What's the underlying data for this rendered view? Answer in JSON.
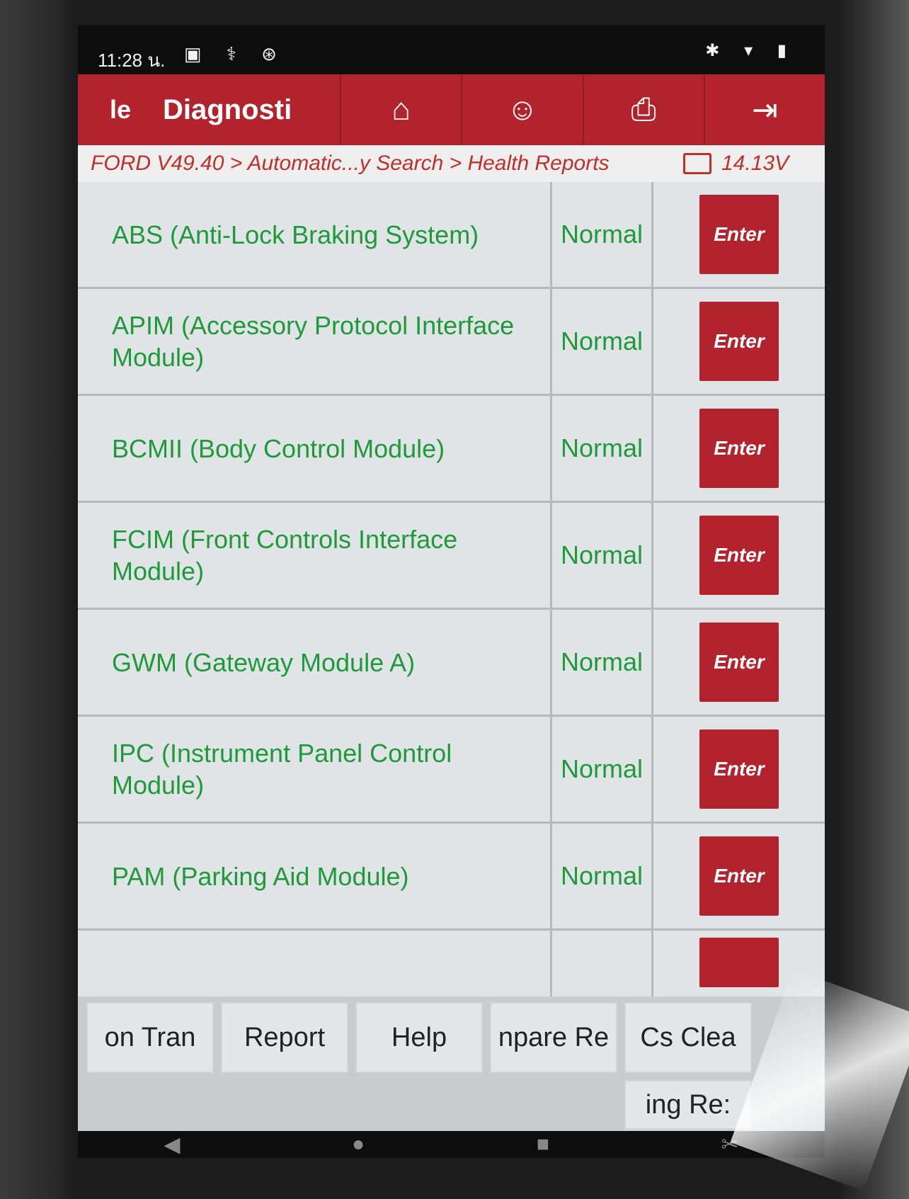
{
  "statusbar": {
    "time": "11:28 น.",
    "left_icons": "▣ ⚕ ⊛",
    "right_icons": "✱ ▾ ▮"
  },
  "topbar": {
    "left_label": "le",
    "title": "Diagnosti",
    "buttons": [
      {
        "icon": "home-icon",
        "glyph": "⌂"
      },
      {
        "icon": "support-icon",
        "glyph": "☺"
      },
      {
        "icon": "print-icon",
        "glyph": "⎙"
      },
      {
        "icon": "exit-icon",
        "glyph": "⇥"
      }
    ]
  },
  "breadcrumb": {
    "path": "FORD V49.40 > Automatic...y Search > Health Reports",
    "voltage": "14.13V"
  },
  "modules": [
    {
      "name": "ABS (Anti-Lock Braking System)",
      "status": "Normal",
      "action": "Enter"
    },
    {
      "name": "APIM (Accessory Protocol Interface Module)",
      "status": "Normal",
      "action": "Enter"
    },
    {
      "name": "BCMII (Body Control Module)",
      "status": "Normal",
      "action": "Enter"
    },
    {
      "name": "FCIM (Front Controls Interface Module)",
      "status": "Normal",
      "action": "Enter"
    },
    {
      "name": "GWM (Gateway Module A)",
      "status": "Normal",
      "action": "Enter"
    },
    {
      "name": "IPC (Instrument Panel Control Module)",
      "status": "Normal",
      "action": "Enter"
    },
    {
      "name": "PAM (Parking Aid Module)",
      "status": "Normal",
      "action": "Enter"
    }
  ],
  "bottom_buttons": {
    "b1": "on    Tran",
    "b2": "Report",
    "b3": "Help",
    "b4": "npare Re",
    "b5": "Cs    Clea",
    "b6": "ing    Re:"
  },
  "navbar": {
    "back": "◀",
    "home": "●",
    "recent": "■",
    "screenshot": "✂"
  }
}
